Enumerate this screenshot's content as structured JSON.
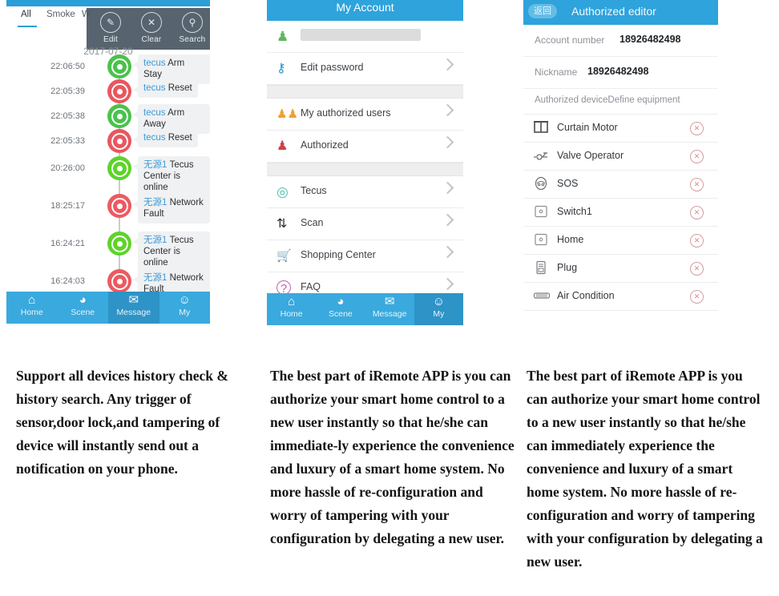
{
  "panel1": {
    "name": "history-screen",
    "tabs": [
      {
        "label": "All",
        "active": true
      },
      {
        "label": "Smoke",
        "active": false
      },
      {
        "label": "W",
        "active": false
      }
    ],
    "toolbar": {
      "items": [
        {
          "label": "Edit",
          "icon": "edit-icon",
          "glyph": "✎"
        },
        {
          "label": "Clear",
          "icon": "close-icon",
          "glyph": "✕"
        },
        {
          "label": "Search",
          "icon": "search-icon",
          "glyph": "⚲"
        }
      ]
    },
    "date_header": "2017-07-20",
    "events": [
      {
        "time": "22:06:50",
        "prefix": "tecus",
        "text": "Arm Stay",
        "state": "armed",
        "color": "#49c24a",
        "icon": "home-shield-icon"
      },
      {
        "time": "22:05:39",
        "prefix": "tecus",
        "text": "Reset",
        "state": "alarm",
        "color": "#e8575f",
        "icon": "home-shield-icon"
      },
      {
        "time": "22:05:38",
        "prefix": "tecus",
        "text": "Arm Away",
        "state": "armed",
        "color": "#49c24a",
        "icon": "home-shield-icon"
      },
      {
        "time": "22:05:33",
        "prefix": "tecus",
        "text": "Reset",
        "state": "alarm",
        "color": "#e8575f",
        "icon": "home-shield-icon"
      },
      {
        "time": "20:26:00",
        "prefix": "无源1",
        "text": "Tecus Center is online",
        "state": "online",
        "color": "#5ed32a",
        "icon": "signal-ring-icon"
      },
      {
        "time": "18:25:17",
        "prefix": "无源1",
        "text": "Network Fault",
        "state": "fault",
        "color": "#ec5a60",
        "icon": "signal-ring-icon"
      },
      {
        "time": "16:24:21",
        "prefix": "无源1",
        "text": "Tecus Center is online",
        "state": "online",
        "color": "#5ed32a",
        "icon": "signal-ring-icon"
      },
      {
        "time": "16:24:03",
        "prefix": "无源1",
        "text": "Network Fault",
        "state": "fault",
        "color": "#ec5a60",
        "icon": "signal-ring-icon"
      }
    ],
    "nav": [
      {
        "label": "Home",
        "icon": "home-wifi-icon",
        "glyph": "⌂",
        "selected": false
      },
      {
        "label": "Scene",
        "icon": "pie-scene-icon",
        "glyph": "◕",
        "selected": false
      },
      {
        "label": "Message",
        "icon": "envelope-icon",
        "glyph": "✉",
        "selected": true
      },
      {
        "label": "My",
        "icon": "person-circle-icon",
        "glyph": "☺",
        "selected": false
      }
    ]
  },
  "panel2": {
    "name": "my-account-screen",
    "header_title": "My Account",
    "account_row": {
      "icon": "user-avatar-icon",
      "value_redacted": true
    },
    "items": [
      {
        "label": "Edit password",
        "icon": "key-icon",
        "glyph": "⚿",
        "color": "#2b8fd0"
      },
      {
        "label": "My authorized users",
        "icon": "users-group-icon",
        "glyph": "⛟",
        "color": "#f0a030"
      },
      {
        "label": "Authorized",
        "icon": "user-badge-icon",
        "glyph": "♟",
        "color": "#d0414a"
      },
      {
        "label": "Tecus",
        "icon": "ring-logo-icon",
        "glyph": "◎",
        "color": "#4dc0ae"
      },
      {
        "label": "Scan",
        "icon": "scan-arrows-icon",
        "glyph": "↻",
        "color": "#2b2f33"
      },
      {
        "label": "Shopping Center",
        "icon": "shopping-cart-icon",
        "glyph": "⛃",
        "color": "#8d6bb5"
      },
      {
        "label": "FAQ",
        "icon": "question-circle-icon",
        "glyph": "?",
        "color": "#c061ad"
      }
    ],
    "nav": [
      {
        "label": "Home",
        "icon": "home-wifi-icon",
        "glyph": "⌂",
        "selected": false
      },
      {
        "label": "Scene",
        "icon": "pie-scene-icon",
        "glyph": "◕",
        "selected": false
      },
      {
        "label": "Message",
        "icon": "envelope-icon",
        "glyph": "✉",
        "selected": false
      },
      {
        "label": "My",
        "icon": "person-circle-icon",
        "glyph": "☺",
        "selected": true
      }
    ]
  },
  "panel3": {
    "name": "authorized-editor-screen",
    "back_label": "返回",
    "header_title": "Authorized editor",
    "fields": [
      {
        "key": "Account number",
        "value": "18926482498"
      },
      {
        "key": "Nickname",
        "value": "18926482498"
      }
    ],
    "section_title": "Authorized deviceDefine equipment",
    "devices": [
      {
        "label": "Curtain Motor",
        "icon": "curtain-icon",
        "remove_icon": "remove-circle-icon"
      },
      {
        "label": "Valve Operator",
        "icon": "valve-icon",
        "remove_icon": "remove-circle-icon"
      },
      {
        "label": "SOS",
        "icon": "sos-icon",
        "remove_icon": "remove-circle-icon"
      },
      {
        "label": "Switch1",
        "icon": "switch-icon",
        "remove_icon": "remove-circle-icon"
      },
      {
        "label": "Home",
        "icon": "switch-icon",
        "remove_icon": "remove-circle-icon"
      },
      {
        "label": "Plug",
        "icon": "plug-icon",
        "remove_icon": "remove-circle-icon"
      },
      {
        "label": "Air Condition",
        "icon": "air-condition-icon",
        "remove_icon": "remove-circle-icon"
      }
    ]
  },
  "captions": {
    "c1": "Support all devices history check & history search. Any trigger of sensor,door lock,and tampering of device will instantly send out a notification on your phone.",
    "c2": "The best part of iRemote APP is you can authorize your smart home control to a new user instantly so that he/she can immediate-ly experience the convenience and luxury of a smart home system. No more hassle of re-configuration and worry of tampering with your configuration by delegating a new user.",
    "c3": "The best part of iRemote APP is you can authorize your smart home control to a new user instantly so that he/she can immediately experience the convenience and luxury of a smart home system. No more hassle of re-configuration and worry of tampering with your configuration by delegating a new user."
  },
  "colors": {
    "brand_blue": "#2ea3dc",
    "nav_blue": "#3aa9dd",
    "nav_selected": "#2e93c6",
    "toolbar_dark": "#4b5965",
    "green": "#49c24a",
    "red": "#e8575f"
  }
}
